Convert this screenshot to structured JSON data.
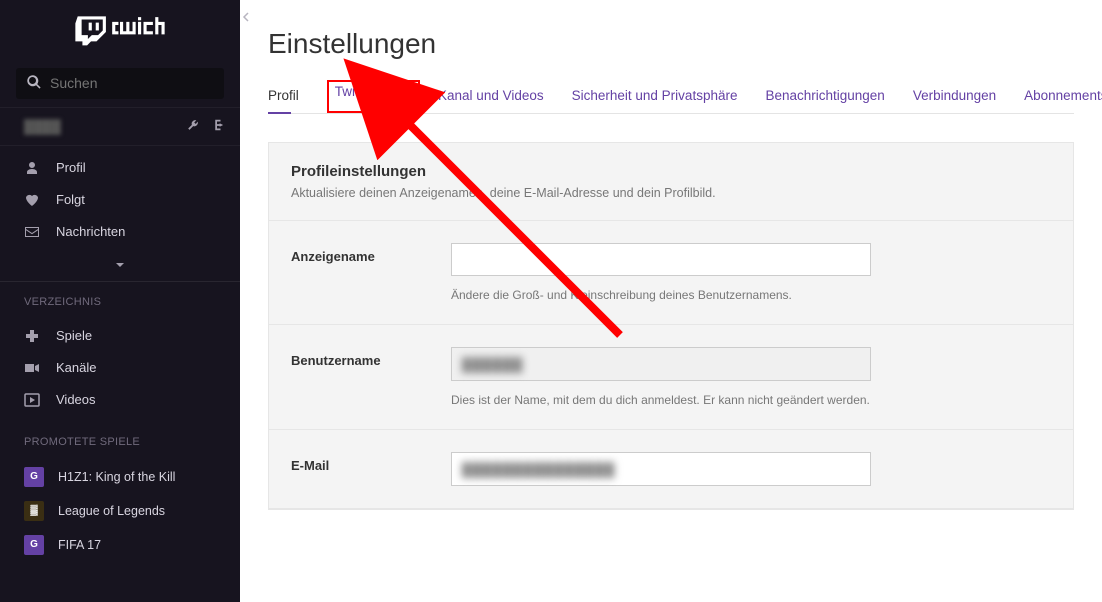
{
  "sidebar": {
    "search_placeholder": "Suchen",
    "nav": [
      {
        "icon": "user",
        "label": "Profil"
      },
      {
        "icon": "heart",
        "label": "Folgt"
      },
      {
        "icon": "envelope",
        "label": "Nachrichten"
      }
    ],
    "directory_title": "VERZEICHNIS",
    "directory": [
      {
        "icon": "gamepad",
        "label": "Spiele"
      },
      {
        "icon": "camera",
        "label": "Kanäle"
      },
      {
        "icon": "play",
        "label": "Videos"
      }
    ],
    "promoted_title": "PROMOTETE SPIELE",
    "games": [
      {
        "key": "h1z1",
        "label": "H1Z1: King of the Kill"
      },
      {
        "key": "lol",
        "label": "League of Legends"
      },
      {
        "key": "fifa",
        "label": "FIFA 17"
      }
    ]
  },
  "main": {
    "page_title": "Einstellungen",
    "tabs": {
      "profil": "Profil",
      "prime": "Twitch Prime",
      "kanal": "Kanal und Videos",
      "sicherheit": "Sicherheit und Privatsphäre",
      "benachrichtigungen": "Benachrichtigungen",
      "verbindungen": "Verbindungen",
      "abonnements": "Abonnements"
    },
    "panel": {
      "title": "Profileinstellungen",
      "subtitle": "Aktualisiere deinen Anzeigenamen, deine E-Mail-Adresse und dein Profilbild.",
      "fields": {
        "display_name": {
          "label": "Anzeigename",
          "value": "",
          "hint": "Ändere die Groß- und Kleinschreibung deines Benutzernamens."
        },
        "username": {
          "label": "Benutzername",
          "value": "",
          "hint": "Dies ist der Name, mit dem du dich anmeldest. Er kann nicht geändert werden."
        },
        "email": {
          "label": "E-Mail",
          "value": ""
        }
      }
    }
  }
}
